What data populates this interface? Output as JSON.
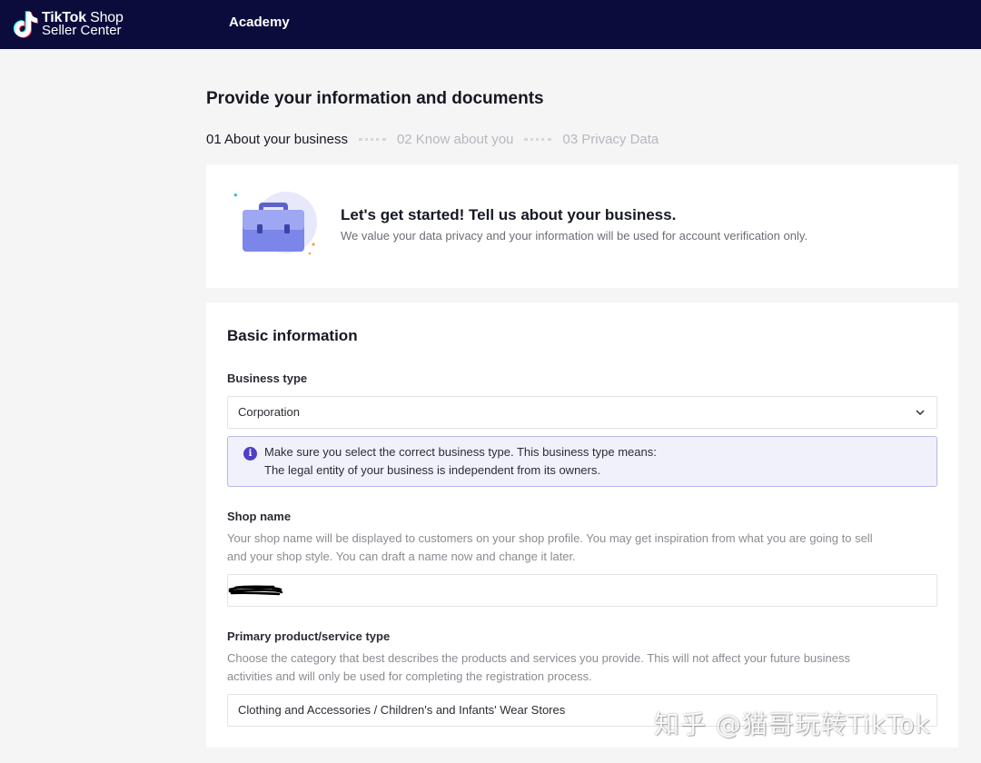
{
  "topbar": {
    "logo_brand": "TikTok",
    "logo_shop": "Shop",
    "logo_sub": "Seller Center",
    "nav_academy": "Academy"
  },
  "page": {
    "title": "Provide your information and documents",
    "steps": [
      {
        "label": "01 About your business",
        "state": "active"
      },
      {
        "label": "02 Know about you",
        "state": "inactive"
      },
      {
        "label": "03 Privacy Data",
        "state": "inactive"
      }
    ]
  },
  "intro": {
    "icon": "briefcase-icon",
    "title": "Let's get started! Tell us about your business.",
    "subtitle": "We value your data privacy and your information will be used for account verification only."
  },
  "form": {
    "section_title": "Basic information",
    "business_type": {
      "label": "Business type",
      "value": "Corporation",
      "info_line1": "Make sure you select the correct business type. This business type means:",
      "info_line2": "The legal entity of your business is independent from its owners."
    },
    "shop_name": {
      "label": "Shop name",
      "help_line1": "Your shop name will be displayed to customers on your shop profile. You may get inspiration from what you are going to sell",
      "help_line2": "and your shop style. You can draft a name now and change it later.",
      "value": ""
    },
    "primary_type": {
      "label": "Primary product/service type",
      "help_line1": "Choose the category that best describes the products and services you provide. This will not affect your future business",
      "help_line2": "activities and will only be used for completing the registration process.",
      "value": "Clothing and Accessories / Children's and Infants' Wear Stores"
    }
  },
  "watermark": "知乎 @猫哥玩转TikTok",
  "colors": {
    "topbar": "#0b0c3b",
    "accent": "#4d3fc7",
    "info_bg": "#f1f1fb",
    "info_border": "#b9b7ea"
  }
}
